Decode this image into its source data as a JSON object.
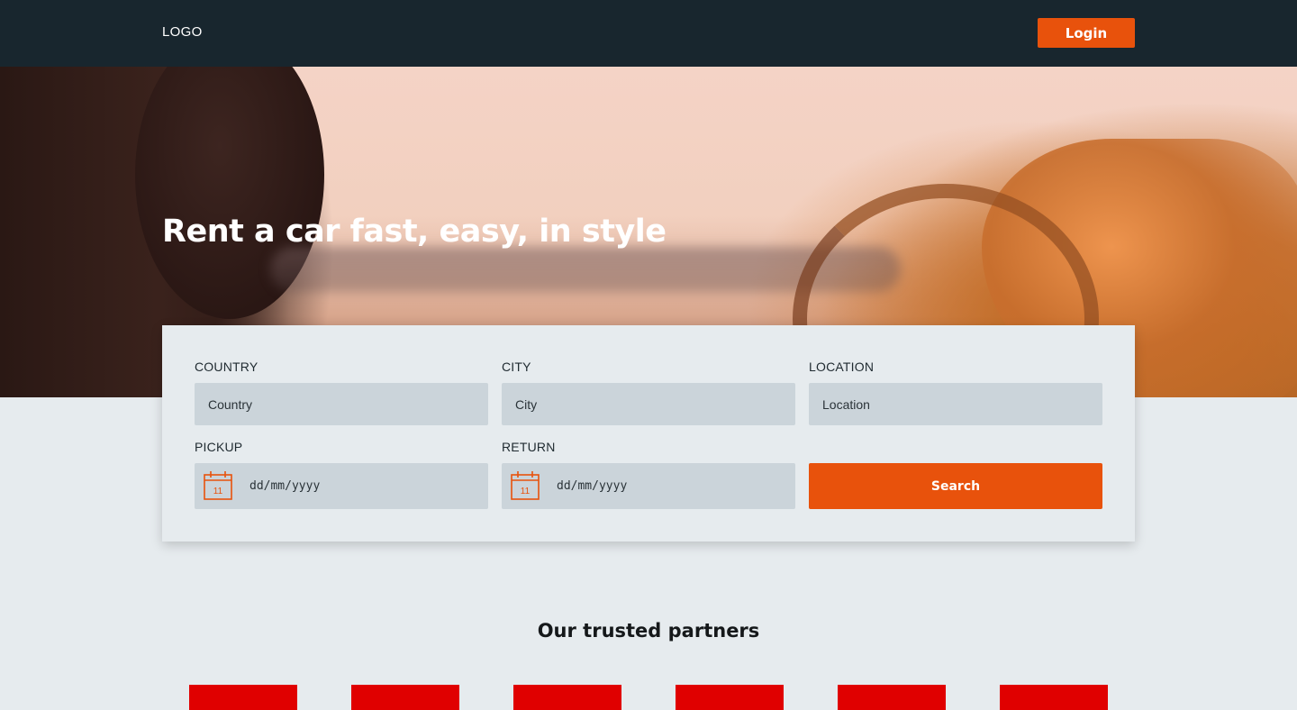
{
  "header": {
    "logo": "LOGO",
    "login_label": "Login",
    "accent_color": "#e8520c",
    "background_color": "#18262e"
  },
  "hero": {
    "title": "Rent a car fast, easy, in style"
  },
  "search_form": {
    "country": {
      "label": "COUNTRY",
      "placeholder": "Country"
    },
    "city": {
      "label": "CITY",
      "placeholder": "City"
    },
    "location": {
      "label": "LOCATION",
      "placeholder": "Location"
    },
    "pickup": {
      "label": "PICKUP",
      "placeholder": "dd/mm/yyyy",
      "calendar_day": "11",
      "icon": "calendar-icon"
    },
    "return": {
      "label": "RETURN",
      "placeholder": "dd/mm/yyyy",
      "calendar_day": "11",
      "icon": "calendar-icon"
    },
    "search_label": "Search"
  },
  "partners": {
    "title": "Our trusted partners",
    "count": 6,
    "logo_color": "#e00000"
  }
}
